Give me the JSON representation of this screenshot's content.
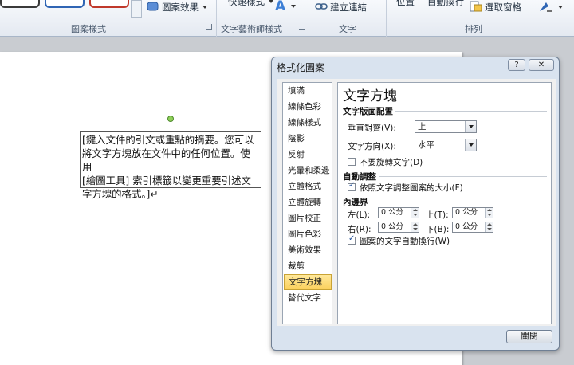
{
  "ribbon": {
    "shape_effects": "圖案效果",
    "quick_styles": "快速樣式",
    "create_link": "建立連結",
    "position": "位置",
    "wrap_text": "自動換行",
    "selection_pane": "選取窗格",
    "groups": {
      "shape_styles": "圖案樣式",
      "wordart_styles": "文字藝術師樣式",
      "text": "文字",
      "arrange": "排列"
    }
  },
  "document": {
    "textbox_lines": [
      "[鍵入文件的引文或重點的摘要。您可以",
      "將文字方塊放在文件中的任何位置。使用",
      "[繪圖工具] 索引標籤以變更重要引述文",
      "字方塊的格式。]↵"
    ]
  },
  "dialog": {
    "title": "格式化圖案",
    "help_label": "?",
    "close_x": "✕",
    "nav": [
      "填滿",
      "線條色彩",
      "線條樣式",
      "陰影",
      "反射",
      "光暈和柔邊",
      "立體格式",
      "立體旋轉",
      "圖片校正",
      "圖片色彩",
      "美術效果",
      "裁剪",
      "文字方塊",
      "替代文字"
    ],
    "selected_nav": "文字方塊",
    "pane_title": "文字方塊",
    "layout_section": "文字版面配置",
    "vertical_align_label": "垂直對齊(V):",
    "vertical_align_value": "上",
    "text_direction_label": "文字方向(X):",
    "text_direction_value": "水平",
    "no_rotate_label": "不要旋轉文字(D)",
    "autofit_section": "自動調整",
    "resize_label": "依照文字調整圖案的大小(F)",
    "margins_section": "內邊界",
    "left_label": "左(L):",
    "left_value": "0 公分",
    "top_label": "上(T):",
    "top_value": "0 公分",
    "right_label": "右(R):",
    "right_value": "0 公分",
    "bottom_label": "下(B):",
    "bottom_value": "0 公分",
    "wrap_label": "圖案的文字自動換行(W)",
    "close_button": "關閉"
  },
  "colors": {
    "selected_nav_bg": "#fbd15d",
    "ribbon_bg": "#e4e9f1",
    "dialog_bg": "#d9e3ef"
  }
}
